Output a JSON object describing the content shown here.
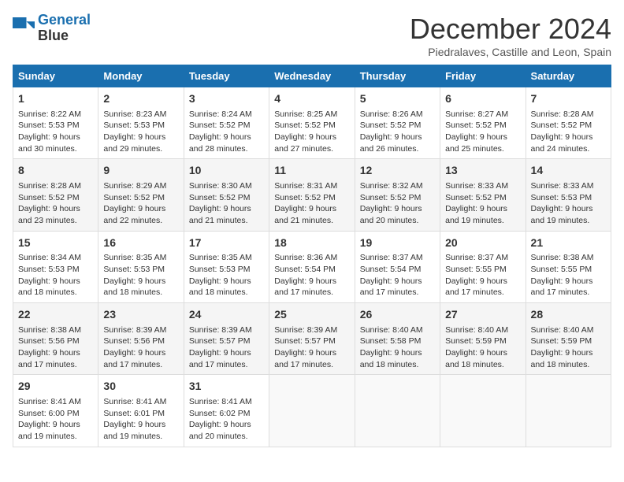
{
  "logo": {
    "line1": "General",
    "line2": "Blue"
  },
  "title": "December 2024",
  "subtitle": "Piedralaves, Castille and Leon, Spain",
  "headers": [
    "Sunday",
    "Monday",
    "Tuesday",
    "Wednesday",
    "Thursday",
    "Friday",
    "Saturday"
  ],
  "weeks": [
    [
      {
        "day": "1",
        "rise": "8:22 AM",
        "set": "5:53 PM",
        "daylight": "9 hours and 30 minutes."
      },
      {
        "day": "2",
        "rise": "8:23 AM",
        "set": "5:53 PM",
        "daylight": "9 hours and 29 minutes."
      },
      {
        "day": "3",
        "rise": "8:24 AM",
        "set": "5:52 PM",
        "daylight": "9 hours and 28 minutes."
      },
      {
        "day": "4",
        "rise": "8:25 AM",
        "set": "5:52 PM",
        "daylight": "9 hours and 27 minutes."
      },
      {
        "day": "5",
        "rise": "8:26 AM",
        "set": "5:52 PM",
        "daylight": "9 hours and 26 minutes."
      },
      {
        "day": "6",
        "rise": "8:27 AM",
        "set": "5:52 PM",
        "daylight": "9 hours and 25 minutes."
      },
      {
        "day": "7",
        "rise": "8:28 AM",
        "set": "5:52 PM",
        "daylight": "9 hours and 24 minutes."
      }
    ],
    [
      {
        "day": "8",
        "rise": "8:28 AM",
        "set": "5:52 PM",
        "daylight": "9 hours and 23 minutes."
      },
      {
        "day": "9",
        "rise": "8:29 AM",
        "set": "5:52 PM",
        "daylight": "9 hours and 22 minutes."
      },
      {
        "day": "10",
        "rise": "8:30 AM",
        "set": "5:52 PM",
        "daylight": "9 hours and 21 minutes."
      },
      {
        "day": "11",
        "rise": "8:31 AM",
        "set": "5:52 PM",
        "daylight": "9 hours and 21 minutes."
      },
      {
        "day": "12",
        "rise": "8:32 AM",
        "set": "5:52 PM",
        "daylight": "9 hours and 20 minutes."
      },
      {
        "day": "13",
        "rise": "8:33 AM",
        "set": "5:52 PM",
        "daylight": "9 hours and 19 minutes."
      },
      {
        "day": "14",
        "rise": "8:33 AM",
        "set": "5:53 PM",
        "daylight": "9 hours and 19 minutes."
      }
    ],
    [
      {
        "day": "15",
        "rise": "8:34 AM",
        "set": "5:53 PM",
        "daylight": "9 hours and 18 minutes."
      },
      {
        "day": "16",
        "rise": "8:35 AM",
        "set": "5:53 PM",
        "daylight": "9 hours and 18 minutes."
      },
      {
        "day": "17",
        "rise": "8:35 AM",
        "set": "5:53 PM",
        "daylight": "9 hours and 18 minutes."
      },
      {
        "day": "18",
        "rise": "8:36 AM",
        "set": "5:54 PM",
        "daylight": "9 hours and 17 minutes."
      },
      {
        "day": "19",
        "rise": "8:37 AM",
        "set": "5:54 PM",
        "daylight": "9 hours and 17 minutes."
      },
      {
        "day": "20",
        "rise": "8:37 AM",
        "set": "5:55 PM",
        "daylight": "9 hours and 17 minutes."
      },
      {
        "day": "21",
        "rise": "8:38 AM",
        "set": "5:55 PM",
        "daylight": "9 hours and 17 minutes."
      }
    ],
    [
      {
        "day": "22",
        "rise": "8:38 AM",
        "set": "5:56 PM",
        "daylight": "9 hours and 17 minutes."
      },
      {
        "day": "23",
        "rise": "8:39 AM",
        "set": "5:56 PM",
        "daylight": "9 hours and 17 minutes."
      },
      {
        "day": "24",
        "rise": "8:39 AM",
        "set": "5:57 PM",
        "daylight": "9 hours and 17 minutes."
      },
      {
        "day": "25",
        "rise": "8:39 AM",
        "set": "5:57 PM",
        "daylight": "9 hours and 17 minutes."
      },
      {
        "day": "26",
        "rise": "8:40 AM",
        "set": "5:58 PM",
        "daylight": "9 hours and 18 minutes."
      },
      {
        "day": "27",
        "rise": "8:40 AM",
        "set": "5:59 PM",
        "daylight": "9 hours and 18 minutes."
      },
      {
        "day": "28",
        "rise": "8:40 AM",
        "set": "5:59 PM",
        "daylight": "9 hours and 18 minutes."
      }
    ],
    [
      {
        "day": "29",
        "rise": "8:41 AM",
        "set": "6:00 PM",
        "daylight": "9 hours and 19 minutes."
      },
      {
        "day": "30",
        "rise": "8:41 AM",
        "set": "6:01 PM",
        "daylight": "9 hours and 19 minutes."
      },
      {
        "day": "31",
        "rise": "8:41 AM",
        "set": "6:02 PM",
        "daylight": "9 hours and 20 minutes."
      },
      null,
      null,
      null,
      null
    ]
  ]
}
